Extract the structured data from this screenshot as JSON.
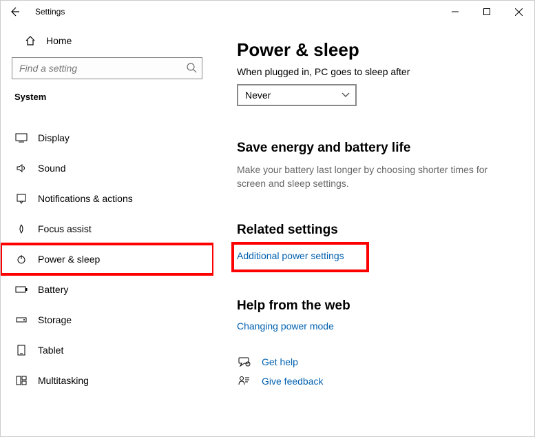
{
  "titlebar": {
    "title": "Settings"
  },
  "sidebar": {
    "home_label": "Home",
    "search_placeholder": "Find a setting",
    "section": "System",
    "items": [
      {
        "label": "Display"
      },
      {
        "label": "Sound"
      },
      {
        "label": "Notifications & actions"
      },
      {
        "label": "Focus assist"
      },
      {
        "label": "Power & sleep"
      },
      {
        "label": "Battery"
      },
      {
        "label": "Storage"
      },
      {
        "label": "Tablet"
      },
      {
        "label": "Multitasking"
      }
    ]
  },
  "content": {
    "heading": "Power & sleep",
    "plugged_label": "When plugged in, PC goes to sleep after",
    "dropdown_value": "Never",
    "energy_heading": "Save energy and battery life",
    "energy_desc": "Make your battery last longer by choosing shorter times for screen and sleep settings.",
    "related_heading": "Related settings",
    "related_link": "Additional power settings",
    "help_heading": "Help from the web",
    "help_link": "Changing power mode",
    "get_help": "Get help",
    "feedback": "Give feedback"
  }
}
